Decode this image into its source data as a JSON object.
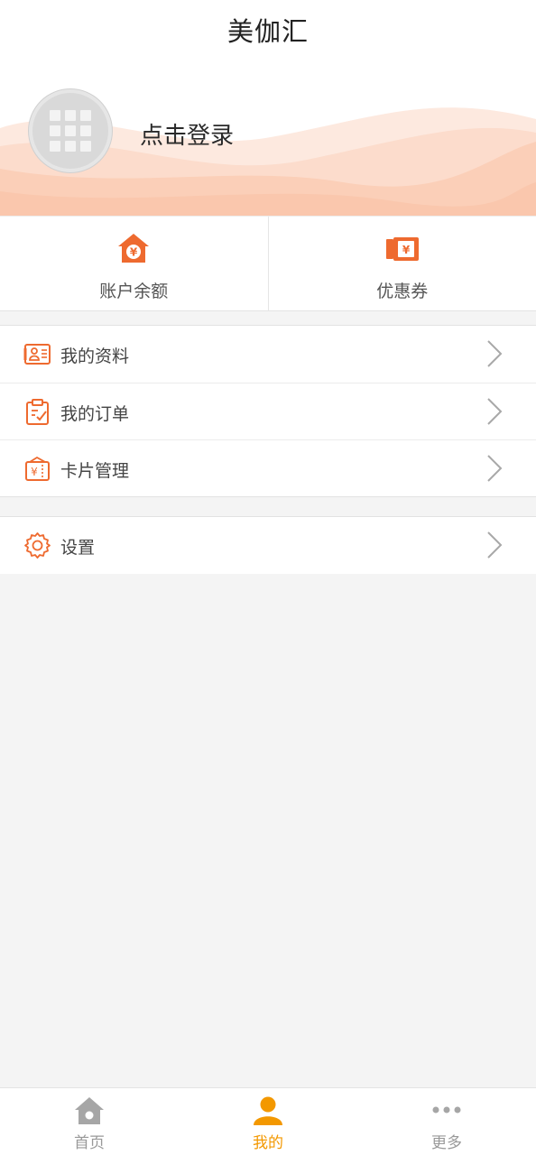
{
  "header": {
    "title": "美伽汇"
  },
  "profile": {
    "login_text": "点击登录"
  },
  "quick_actions": [
    {
      "label": "账户余额",
      "icon": "wallet-house-yen-icon"
    },
    {
      "label": "优惠券",
      "icon": "coupon-yen-icon"
    }
  ],
  "menu": [
    {
      "label": "我的资料",
      "icon": "id-card-icon"
    },
    {
      "label": "我的订单",
      "icon": "clipboard-check-icon"
    },
    {
      "label": "卡片管理",
      "icon": "card-yen-icon"
    }
  ],
  "settings": {
    "label": "设置",
    "icon": "gear-icon"
  },
  "tabbar": {
    "items": [
      {
        "label": "首页",
        "icon": "home-icon"
      },
      {
        "label": "我的",
        "icon": "user-icon",
        "active": true
      },
      {
        "label": "更多",
        "icon": "more-dots-icon"
      }
    ]
  },
  "colors": {
    "accent_orange": "#f39800",
    "icon_orange": "#ee6a2f",
    "wave_peach": "#fcd3bf",
    "inactive_gray": "#999999",
    "background": "#f4f4f4"
  }
}
